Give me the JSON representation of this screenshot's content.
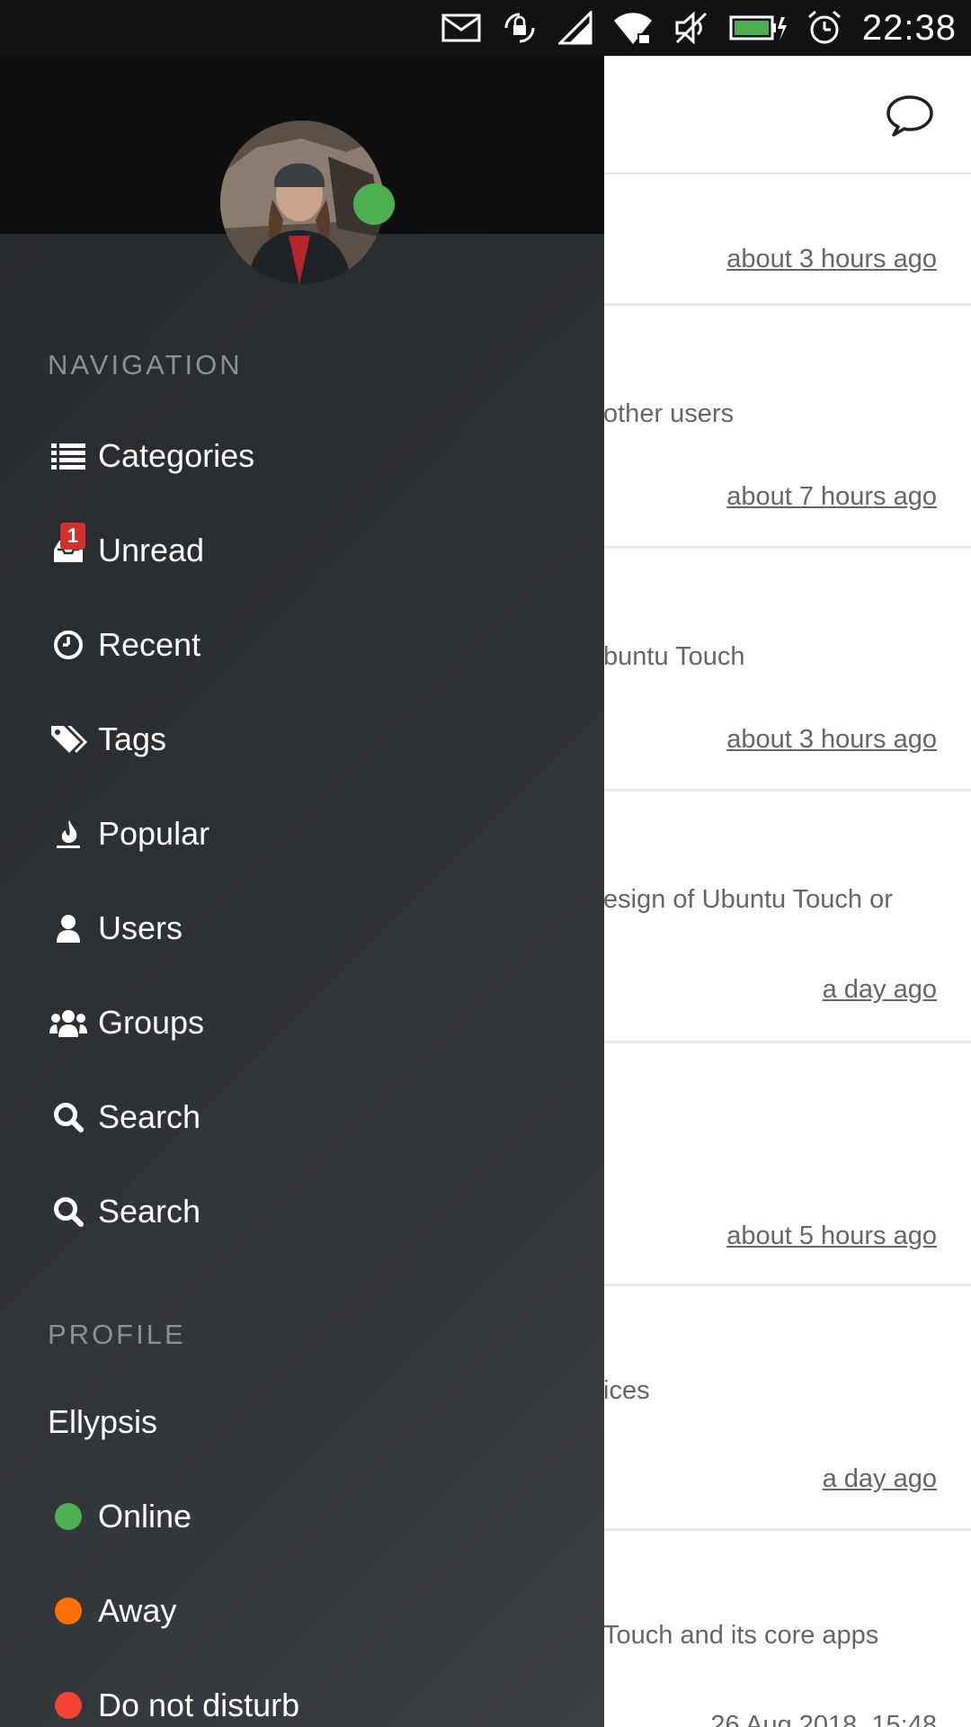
{
  "status_bar": {
    "time": "22:38",
    "icons": [
      "mail-icon",
      "screen-rotation-lock-icon",
      "cell-signal-icon",
      "wifi-lock-icon",
      "muted-icon",
      "battery-charging-icon",
      "alarm-icon"
    ]
  },
  "background": {
    "cards": [
      {
        "snippet": "",
        "time": "about 3 hours ago"
      },
      {
        "snippet": "other users",
        "time": "about 7 hours ago"
      },
      {
        "snippet": "buntu Touch",
        "time": "about 3 hours ago"
      },
      {
        "snippet": "esign of Ubuntu Touch or",
        "time": "a day ago"
      },
      {
        "snippet": "",
        "time": "about 5 hours ago"
      },
      {
        "snippet": "ices",
        "time": "a day ago"
      },
      {
        "snippet": "Touch and its core apps",
        "time": "26 Aug 2018, 15:48"
      }
    ]
  },
  "drawer": {
    "navigation_heading": "NAVIGATION",
    "nav_items": [
      {
        "label": "Categories",
        "icon": "list-icon"
      },
      {
        "label": "Unread",
        "icon": "inbox-icon",
        "badge": "1"
      },
      {
        "label": "Recent",
        "icon": "clock-icon"
      },
      {
        "label": "Tags",
        "icon": "tags-icon"
      },
      {
        "label": "Popular",
        "icon": "fire-icon"
      },
      {
        "label": "Users",
        "icon": "user-icon"
      },
      {
        "label": "Groups",
        "icon": "group-icon"
      },
      {
        "label": "Search",
        "icon": "search-icon"
      },
      {
        "label": "Search",
        "icon": "search-icon"
      }
    ],
    "profile_heading": "PROFILE",
    "username": "Ellypsis",
    "statuses": [
      {
        "label": "Online",
        "color": "#4caf50"
      },
      {
        "label": "Away",
        "color": "#ff6f00"
      },
      {
        "label": "Do not disturb",
        "color": "#f44336"
      }
    ],
    "avatar_status_color": "#4caf50"
  }
}
